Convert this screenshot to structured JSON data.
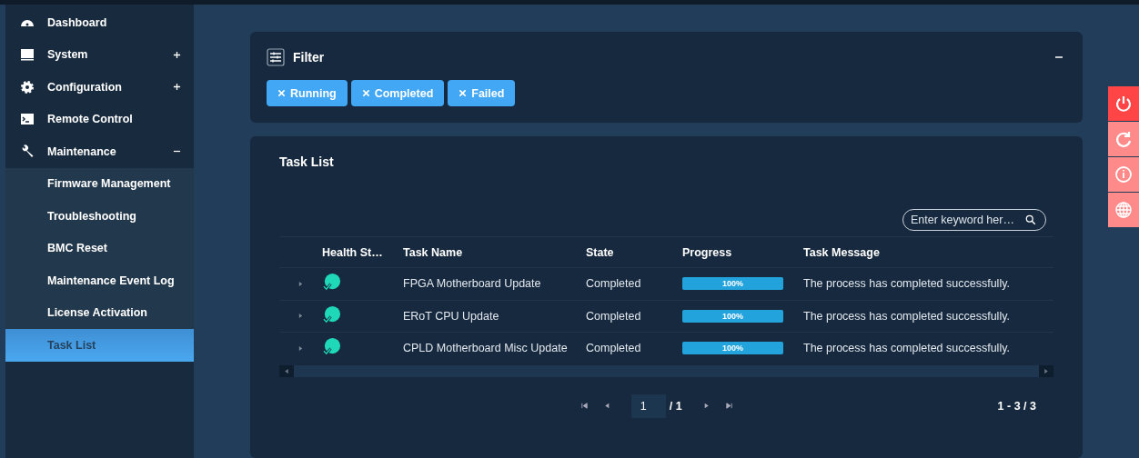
{
  "sidebar": {
    "items": [
      {
        "label": "Dashboard",
        "selected": false
      },
      {
        "label": "System",
        "expanded": false,
        "selected": false
      },
      {
        "label": "Configuration",
        "expanded": false,
        "selected": false
      },
      {
        "label": "Remote Control",
        "selected": false
      },
      {
        "label": "Maintenance",
        "expanded": true,
        "selected": false,
        "children": [
          {
            "label": "Firmware Management",
            "selected": false
          },
          {
            "label": "Troubleshooting",
            "selected": false
          },
          {
            "label": "BMC Reset",
            "selected": false
          },
          {
            "label": "Maintenance Event Log",
            "selected": false
          },
          {
            "label": "License Activation",
            "selected": false
          },
          {
            "label": "Task List",
            "selected": true
          }
        ]
      }
    ]
  },
  "filter": {
    "title": "Filter",
    "expanded": true,
    "tags": [
      "Running",
      "Completed",
      "Failed"
    ]
  },
  "task_list": {
    "title": "Task List",
    "search": {
      "placeholder": "Enter keyword her…"
    },
    "columns": [
      "Health St…",
      "Task Name",
      "State",
      "Progress",
      "Task Message"
    ],
    "rows": [
      {
        "kind": "ok",
        "name": "FPGA Motherboard Update",
        "state": "Completed",
        "level": 1,
        "progress_label": "100%",
        "message": "The process has completed successfully."
      },
      {
        "kind": "ok",
        "name": "ERoT CPU Update",
        "state": "Completed",
        "level": 1,
        "progress_label": "100%",
        "message": "The process has completed successfully."
      },
      {
        "kind": "ok",
        "name": "CPLD Motherboard Misc Update",
        "state": "Completed",
        "level": 1,
        "progress_label": "100%",
        "message": "The process has completed successfully."
      }
    ],
    "pagination": {
      "page": "1",
      "total_pages": "/ 1",
      "range": "1 - 3 / 3"
    }
  },
  "side_actions": [
    {
      "kind": "power",
      "highlighted": true
    },
    {
      "kind": "refresh",
      "highlighted": false
    },
    {
      "kind": "info",
      "highlighted": false
    },
    {
      "kind": "globe",
      "highlighted": false
    }
  ]
}
